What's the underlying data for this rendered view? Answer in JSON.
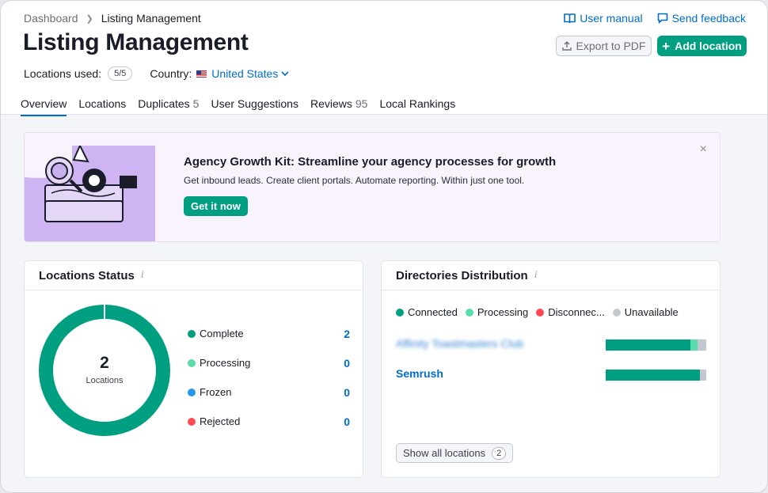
{
  "breadcrumb": {
    "root": "Dashboard",
    "current": "Listing Management"
  },
  "page_title": "Listing Management",
  "toplinks": {
    "manual": "User manual",
    "feedback": "Send feedback"
  },
  "buttons": {
    "export": "Export to PDF",
    "add": "Add location"
  },
  "meta": {
    "used_label": "Locations used:",
    "used_value": "5/5",
    "country_label": "Country:",
    "country_value": "United States"
  },
  "tabs": [
    {
      "label": "Overview",
      "count": ""
    },
    {
      "label": "Locations",
      "count": ""
    },
    {
      "label": "Duplicates",
      "count": "5"
    },
    {
      "label": "User Suggestions",
      "count": ""
    },
    {
      "label": "Reviews",
      "count": "95"
    },
    {
      "label": "Local Rankings",
      "count": ""
    }
  ],
  "banner": {
    "title": "Agency Growth Kit: Streamline your agency processes for growth",
    "text": "Get inbound leads. Create client portals. Automate reporting. Within just one tool.",
    "cta": "Get it now",
    "close": "×"
  },
  "locations_status": {
    "title": "Locations Status",
    "info": "i",
    "total": "2",
    "total_label": "Locations",
    "items": [
      {
        "name": "Complete",
        "value": "2",
        "color": "#009f81"
      },
      {
        "name": "Processing",
        "value": "0",
        "color": "#59ddaa"
      },
      {
        "name": "Frozen",
        "value": "0",
        "color": "#2196f3"
      },
      {
        "name": "Rejected",
        "value": "0",
        "color": "#ff4953"
      }
    ]
  },
  "directories": {
    "title": "Directories Distribution",
    "info": "i",
    "legend": [
      {
        "name": "Connected",
        "color": "#009f81"
      },
      {
        "name": "Processing",
        "color": "#59ddaa"
      },
      {
        "name": "Disconnec...",
        "color": "#ff4953"
      },
      {
        "name": "Unavailable",
        "color": "#c4c7cf"
      }
    ],
    "rows": [
      {
        "name": "Affinity Toastmasters Club",
        "blurred": true,
        "connected": 0.84,
        "processing": 0.07,
        "unavailable": 0.09
      },
      {
        "name": "Semrush",
        "blurred": false,
        "connected": 0.94,
        "processing": 0.0,
        "unavailable": 0.06
      }
    ],
    "show_all": "Show all locations",
    "show_all_count": "2"
  },
  "icons": {
    "manual": "book-icon",
    "feedback": "chat-icon",
    "export": "export-icon",
    "add": "plus-icon",
    "chevron": "chevron-down-icon",
    "flag": "us-flag-icon",
    "breadcrumb_sep": "chevron-right-icon"
  },
  "colors": {
    "accent": "#006dca",
    "brand_green": "#009f81"
  }
}
